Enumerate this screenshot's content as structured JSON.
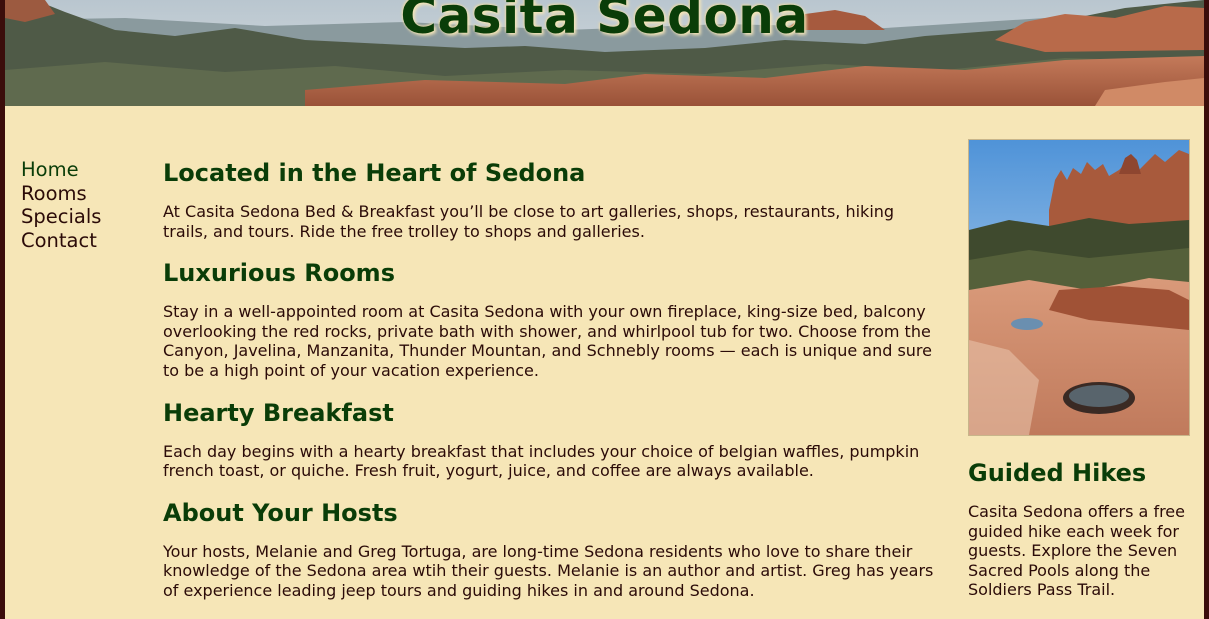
{
  "site": {
    "title": "Casita Sedona"
  },
  "nav": {
    "items": [
      {
        "label": "Home"
      },
      {
        "label": "Rooms"
      },
      {
        "label": "Specials"
      },
      {
        "label": "Contact"
      }
    ]
  },
  "main": {
    "sections": [
      {
        "heading": "Located in the Heart of Sedona",
        "text": "At Casita Sedona Bed & Breakfast you’ll be close to art galleries, shops, restaurants, hiking trails, and tours. Ride the free trolley to shops and galleries."
      },
      {
        "heading": "Luxurious Rooms",
        "text": "Stay in a well-appointed room at Casita Sedona with your own fireplace, king-size bed, balcony overlooking the red rocks, private bath with shower, and whirlpool tub for two. Choose from the Canyon, Javelina, Manzanita, Thunder Mountan, and Schnebly rooms — each is unique and sure to be a high point of your vacation experience."
      },
      {
        "heading": "Hearty Breakfast",
        "text": "Each day begins with a hearty breakfast that includes your choice of belgian waffles, pumpkin french toast, or quiche. Fresh fruit, yogurt, juice, and coffee are always available."
      },
      {
        "heading": "About Your Hosts",
        "text": "Your hosts, Melanie and Greg Tortuga, are long-time Sedona residents who love to share their knowledge of the Sedona area wtih their guests. Melanie is an author and artist. Greg has years of experience leading jeep tours and guiding hikes in and around Sedona."
      }
    ]
  },
  "aside": {
    "heading": "Guided Hikes",
    "text": "Casita Sedona offers a free guided hike each week for guests. Explore the Seven Sacred Pools along the Soldiers Pass Trail."
  },
  "colors": {
    "background": "#f6e6b7",
    "frame": "#3b0d0b",
    "heading": "#0a3d08",
    "text": "#2b0b08"
  }
}
